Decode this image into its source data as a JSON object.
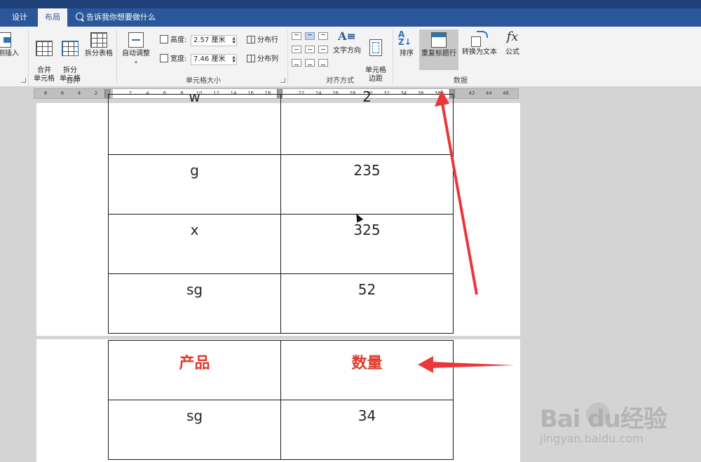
{
  "tabs": {
    "design": "设计",
    "layout": "布局",
    "tell_me": "告诉我你想要做什么"
  },
  "ribbon": {
    "insert_right": "右侧插入",
    "merge_group": {
      "label": "合并",
      "merge_cells": "合并\n单元格",
      "split_cells": "拆分\n单元格",
      "split_table": "拆分表格"
    },
    "cell_size_group": {
      "label": "单元格大小",
      "auto_fit": "自动调整",
      "height_label": "高度:",
      "height_value": "2.57 厘米",
      "width_label": "宽度:",
      "width_value": "7.46 厘米",
      "distribute_rows": "分布行",
      "distribute_cols": "分布列"
    },
    "alignment_group": {
      "label": "对齐方式",
      "text_direction": "文字方向",
      "cell_margins": "单元格\n边距"
    },
    "data_group": {
      "label": "数据",
      "sort": "排序",
      "repeat_header": "重复标题行",
      "convert_to_text": "转换为文本",
      "formula": "公式",
      "formula_glyph": "fx"
    }
  },
  "ruler": {
    "ticks_left": [
      "8",
      "6",
      "4",
      "2"
    ],
    "ticks_mid": [
      "2",
      "4",
      "6",
      "8",
      "10",
      "12",
      "14",
      "16",
      "18"
    ],
    "ticks_right": [
      "22",
      "24",
      "26",
      "28",
      "30",
      "32",
      "34",
      "36",
      "38",
      "",
      "42",
      "44",
      "46"
    ]
  },
  "table_page1": [
    [
      "w",
      "2"
    ],
    [
      "g",
      "235"
    ],
    [
      "x",
      "325"
    ],
    [
      "sg",
      "52"
    ]
  ],
  "table_page2": {
    "header": [
      "产品",
      "数量"
    ],
    "rows": [
      [
        "sg",
        "34"
      ]
    ]
  },
  "watermark": {
    "brand": "Bai  du经验",
    "url": "jingyan.baidu.com"
  },
  "colors": {
    "tab_bar": "#2b579a",
    "ribbon_bg": "#f3f3f3",
    "header_text_red": "#e03a2c",
    "annotation_arrow": "#e8383a"
  },
  "icons": {
    "tell_me": "search-icon",
    "annotation": "red-arrow"
  }
}
